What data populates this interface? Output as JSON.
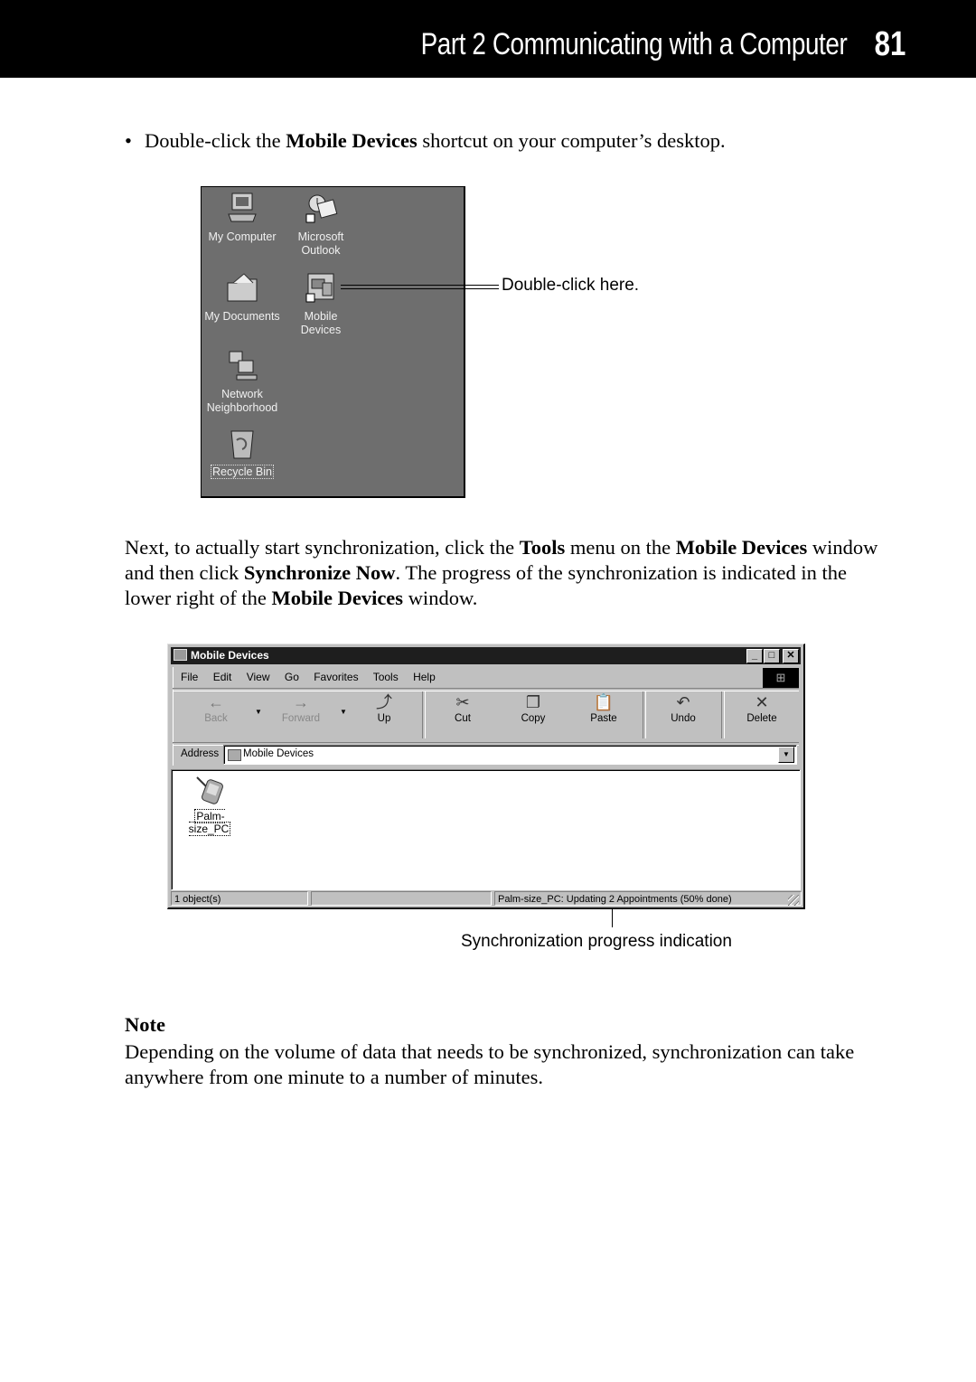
{
  "header": {
    "title": "Part 2  Communicating with a Computer",
    "page_number": "81"
  },
  "bullet": {
    "text_before": "Double-click the ",
    "bold": "Mobile Devices",
    "text_after": " shortcut on your computer’s desktop."
  },
  "desktop": {
    "icons": [
      {
        "name": "my-computer",
        "label": "My Computer"
      },
      {
        "name": "microsoft-outlook",
        "label": "Microsoft Outlook"
      },
      {
        "name": "my-documents",
        "label": "My Documents"
      },
      {
        "name": "mobile-devices",
        "label": "Mobile Devices"
      },
      {
        "name": "network-neighborhood",
        "label": "Network Neighborhood"
      },
      {
        "name": "recycle-bin",
        "label": "Recycle Bin"
      }
    ],
    "callout": "Double-click here."
  },
  "paragraph2": {
    "t1": "Next, to actually start synchronization, click the ",
    "b1": "Tools",
    "t2": " menu on the ",
    "b2": "Mobile Devices",
    "t3": " window and then click ",
    "b3": "Synchronize Now",
    "t4": ". The progress of the synchronization is indicated in the lower right of the ",
    "b4": "Mobile Devices",
    "t5": " window."
  },
  "window": {
    "title": "Mobile Devices",
    "buttons": {
      "minimize": "_",
      "maximize": "□",
      "close": "✕"
    },
    "menu": [
      "File",
      "Edit",
      "View",
      "Go",
      "Favorites",
      "Tools",
      "Help"
    ],
    "toolbar": [
      {
        "label": "Back",
        "icon": "←",
        "disabled": true
      },
      {
        "label": "Forward",
        "icon": "→",
        "disabled": true
      },
      {
        "label": "Up",
        "icon": "⤴"
      },
      {
        "label": "Cut",
        "icon": "✂"
      },
      {
        "label": "Copy",
        "icon": "❐"
      },
      {
        "label": "Paste",
        "icon": "📋"
      },
      {
        "label": "Undo",
        "icon": "↶"
      },
      {
        "label": "Delete",
        "icon": "✕"
      }
    ],
    "address_label": "Address",
    "address_value": "Mobile Devices",
    "items": [
      {
        "label": "Palm-size_PC"
      }
    ],
    "status": {
      "objects": "1 object(s)",
      "middle": "",
      "progress": "Palm-size_PC: Updating 2 Appointments (50% done)"
    }
  },
  "sync_callout": "Synchronization progress indication",
  "note": {
    "title": "Note",
    "body": "Depending on the volume of data that needs to be synchronized, synchronization can take anywhere from one minute to a number of minutes."
  }
}
